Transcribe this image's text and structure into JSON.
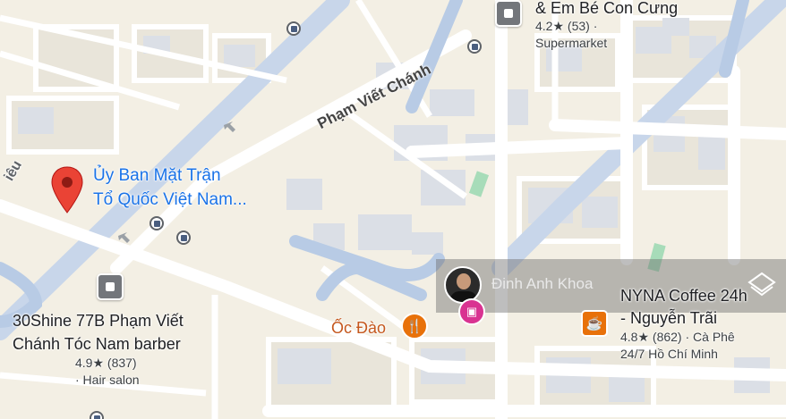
{
  "map": {
    "colors": {
      "land": "#f3efe4",
      "block": "#eae6dc",
      "building": "#dcdfe5",
      "road": "#ffffff",
      "major_road": "#c5d4e8",
      "canal": "#b5c8e4",
      "park": "#a8dbb8",
      "red_pin": "#ea4335",
      "place_text": "#1a73e8",
      "food_text": "#c5581e"
    },
    "road_label": "Phạm Viết Chánh",
    "road_label_left": "iêu",
    "pinned_place": {
      "icon": "red-location-pin",
      "line1": "Ủy Ban Mặt Trận",
      "line2": "Tổ Quốc Việt Nam..."
    },
    "supermarket": {
      "name": "& Em Bé Con Cưng",
      "rating": "4.2★ (53) ·",
      "category": "Supermarket"
    },
    "barber": {
      "line1": "30Shine 77B Phạm Viết",
      "line2": "Chánh Tóc Nam barber",
      "rating": "4.9★ (837)",
      "category": "· Hair salon"
    },
    "restaurant": {
      "name": "Ốc Đào",
      "icon": "fork-knife-icon"
    },
    "cafe": {
      "line1": "NYNA Coffee 24h",
      "line2": "- Nguyễn Trãi",
      "meta1": "4.8★ (862) · Cà Phê",
      "meta2": "24/7 Hồ Chí Minh",
      "icon": "coffee-cup-icon"
    },
    "user": {
      "name": "Đinh Anh Khoa"
    }
  }
}
